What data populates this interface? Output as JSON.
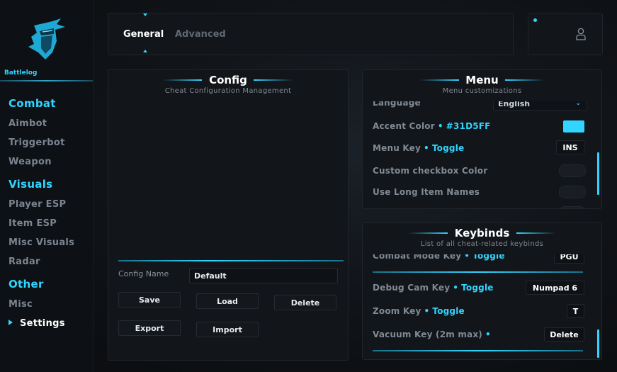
{
  "sidebar": {
    "brand": "Battlelog",
    "items": [
      {
        "label": "Combat",
        "kind": "head"
      },
      {
        "label": "Aimbot",
        "kind": "item"
      },
      {
        "label": "Triggerbot",
        "kind": "item"
      },
      {
        "label": "Weapon",
        "kind": "item"
      },
      {
        "label": "Visuals",
        "kind": "head"
      },
      {
        "label": "Player ESP",
        "kind": "item"
      },
      {
        "label": "Item ESP",
        "kind": "item"
      },
      {
        "label": "Misc Visuals",
        "kind": "item"
      },
      {
        "label": "Radar",
        "kind": "item"
      },
      {
        "label": "Other",
        "kind": "head"
      },
      {
        "label": "Misc",
        "kind": "item"
      },
      {
        "label": "Settings",
        "kind": "active"
      }
    ]
  },
  "tabs": [
    "General",
    "Advanced"
  ],
  "user": {
    "icon": "user-icon"
  },
  "config": {
    "title": "Config",
    "subtitle": "Cheat Configuration Management",
    "name_label": "Config Name",
    "name_value": "Default",
    "buttons": [
      "Save",
      "Load",
      "Delete",
      "Export",
      "Import"
    ]
  },
  "menu": {
    "title": "Menu",
    "subtitle": "Menu customizations",
    "language_label": "Language",
    "language_value": "English",
    "accent_label": "Accent Color",
    "accent_value": "#31D5FF",
    "menu_key_label": "Menu Key",
    "menu_key_mode": "Toggle",
    "menu_key_value": "INS",
    "custom_checkbox_label": "Custom checkbox Color",
    "long_names_label": "Use Long Item Names"
  },
  "keybinds": {
    "title": "Keybinds",
    "subtitle": "List of all cheat-related keybinds",
    "combat_mode_label": "Combat Mode Key",
    "combat_mode_mode": "Toggle",
    "combat_mode_value": "PGU",
    "debug_cam_label": "Debug Cam Key",
    "debug_cam_mode": "Toggle",
    "debug_cam_value": "Numpad 6",
    "zoom_label": "Zoom Key",
    "zoom_mode": "Toggle",
    "zoom_value": "T",
    "vacuum_label": "Vacuum Key (2m max)",
    "vacuum_value": "Delete"
  },
  "colors": {
    "accent": "#31D5FF",
    "panel": "#121519",
    "background": "#0B0E12"
  }
}
